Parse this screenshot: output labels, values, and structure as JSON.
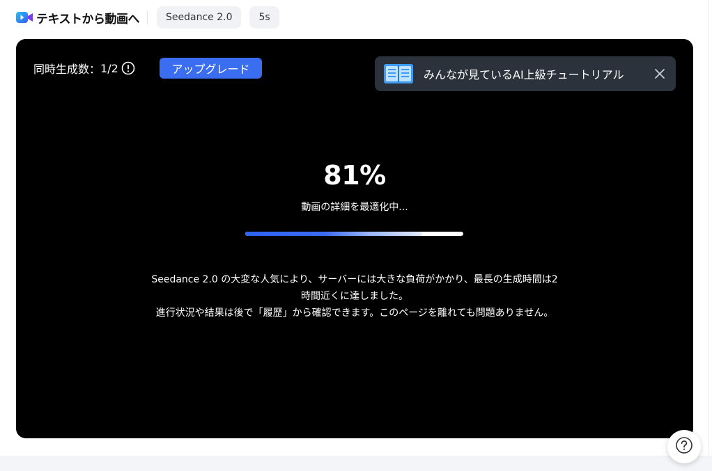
{
  "header": {
    "mode_title": "テキストから動画へ",
    "model_chip": "Seedance 2.0",
    "duration_chip": "5s"
  },
  "panel": {
    "concurrency_label": "同時生成数：",
    "concurrency_value": "1/2",
    "upgrade_label": "アップグレード",
    "banner_text": "みんなが見ているAI上級チュートリアル",
    "progress_text": "81%",
    "progress_value": 81,
    "status_text": "動画の詳細を最適化中...",
    "notice_line1": "Seedance 2.0 の大変な人気により、サーバーには大きな負荷がかかり、最長の生成時間は2",
    "notice_line2": "時間近くに達しました。",
    "notice_line3": "進行状況や結果は後で「履歴」から確認できます。このページを離れても問題ありません。"
  },
  "colors": {
    "accent": "#3a6df0",
    "panel_bg": "#000000",
    "banner_bg": "#2b323c"
  },
  "icons": {
    "mode": "video-camera-icon",
    "info": "info-icon",
    "banner": "book-icon",
    "close": "close-icon",
    "help": "question-icon"
  }
}
